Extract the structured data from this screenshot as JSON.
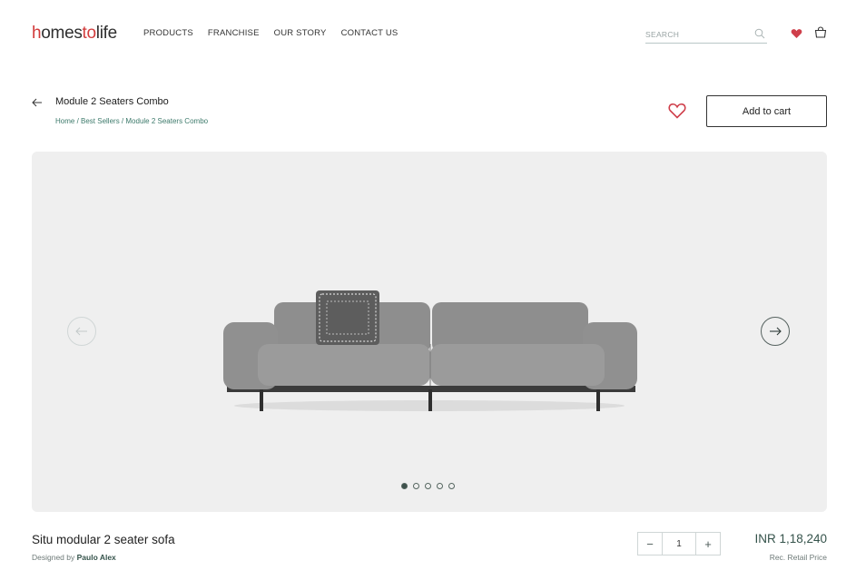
{
  "header": {
    "logo": {
      "part1": "h",
      "part2": "omes",
      "part3": "to",
      "part4": "life"
    },
    "nav": [
      "PRODUCTS",
      "FRANCHISE",
      "OUR STORY",
      "CONTACT US"
    ],
    "search": {
      "placeholder": "SEARCH",
      "value": ""
    }
  },
  "product": {
    "page_title": "Module 2 Seaters Combo",
    "breadcrumb": [
      "Home",
      "Best Sellers",
      "Module 2 Seaters Combo"
    ],
    "breadcrumb_separator": " / ",
    "add_to_cart_label": "Add to cart",
    "name": "Situ modular 2 seater sofa",
    "designed_by_prefix": "Designed by ",
    "designer": "Paulo Alex",
    "quantity": "1",
    "qty_minus": "−",
    "qty_plus": "+",
    "price": "INR 1,18,240",
    "price_note": "Rec. Retail Price"
  },
  "carousel": {
    "slides": 5,
    "active_index": 0
  },
  "icons": {
    "search": "search-icon",
    "wishlist": "heart-icon",
    "bag": "shopping-bag-icon",
    "back": "arrow-left-icon",
    "prev": "arrow-left-icon",
    "next": "arrow-right-icon"
  },
  "colors": {
    "brand_red": "#d23c3c",
    "accent_green": "#35534b",
    "hero_bg": "#efefef"
  }
}
